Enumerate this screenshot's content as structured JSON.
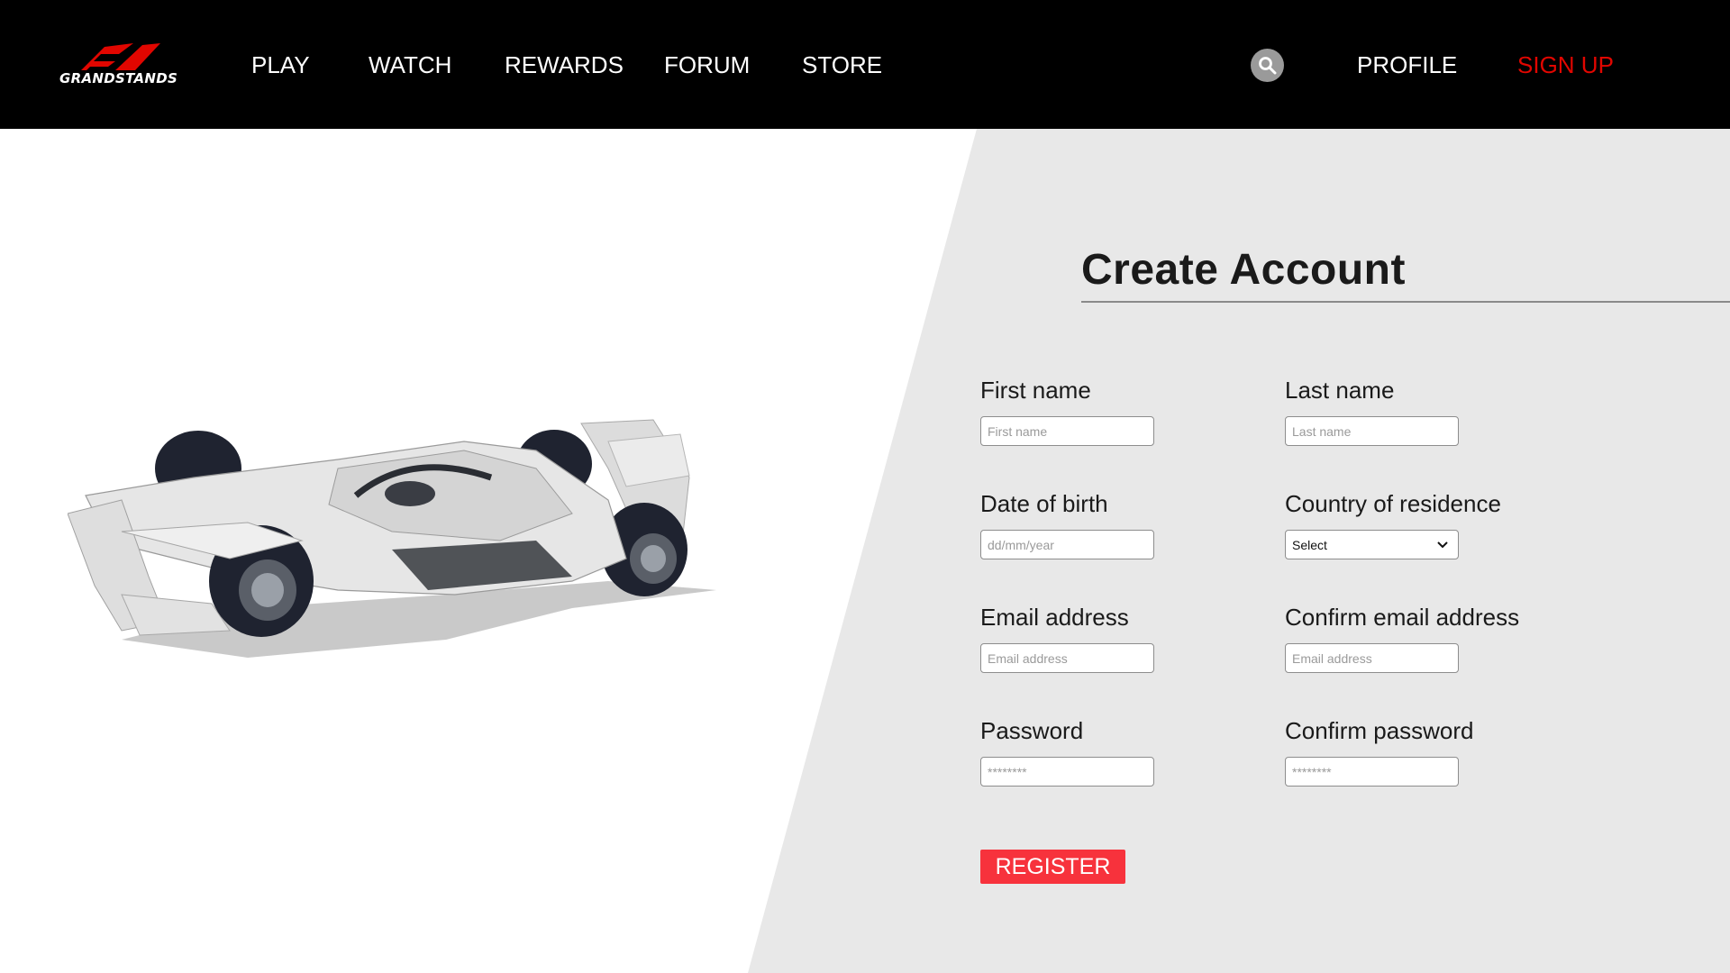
{
  "brand": {
    "logo_text": "GRANDSTANDS",
    "accent": "#e10600"
  },
  "nav": {
    "items": [
      {
        "label": "PLAY"
      },
      {
        "label": "WATCH"
      },
      {
        "label": "REWARDS"
      },
      {
        "label": "FORUM"
      },
      {
        "label": "STORE"
      }
    ],
    "search_icon": "search-icon",
    "profile_label": "PROFILE",
    "signup_label": "SIGN UP",
    "signup_color": "#e10600"
  },
  "hero": {
    "image": "race-car-image"
  },
  "form": {
    "title": "Create Account",
    "first_name": {
      "label": "First name",
      "placeholder": "First name"
    },
    "last_name": {
      "label": "Last name",
      "placeholder": "Last name"
    },
    "dob": {
      "label": "Date of birth",
      "placeholder": "dd/mm/year"
    },
    "country": {
      "label": "Country of residence",
      "selected": "Select"
    },
    "email": {
      "label": "Email address",
      "placeholder": "Email address"
    },
    "confirm_email": {
      "label": "Confirm email address",
      "placeholder": "Email address"
    },
    "password": {
      "label": "Password",
      "placeholder": "********"
    },
    "confirm_password": {
      "label": "Confirm password",
      "placeholder": "********"
    },
    "register_label": "REGISTER",
    "register_color": "#f7323c"
  },
  "colors": {
    "panel": "#e8e8e8",
    "nav_bg": "#000000"
  }
}
